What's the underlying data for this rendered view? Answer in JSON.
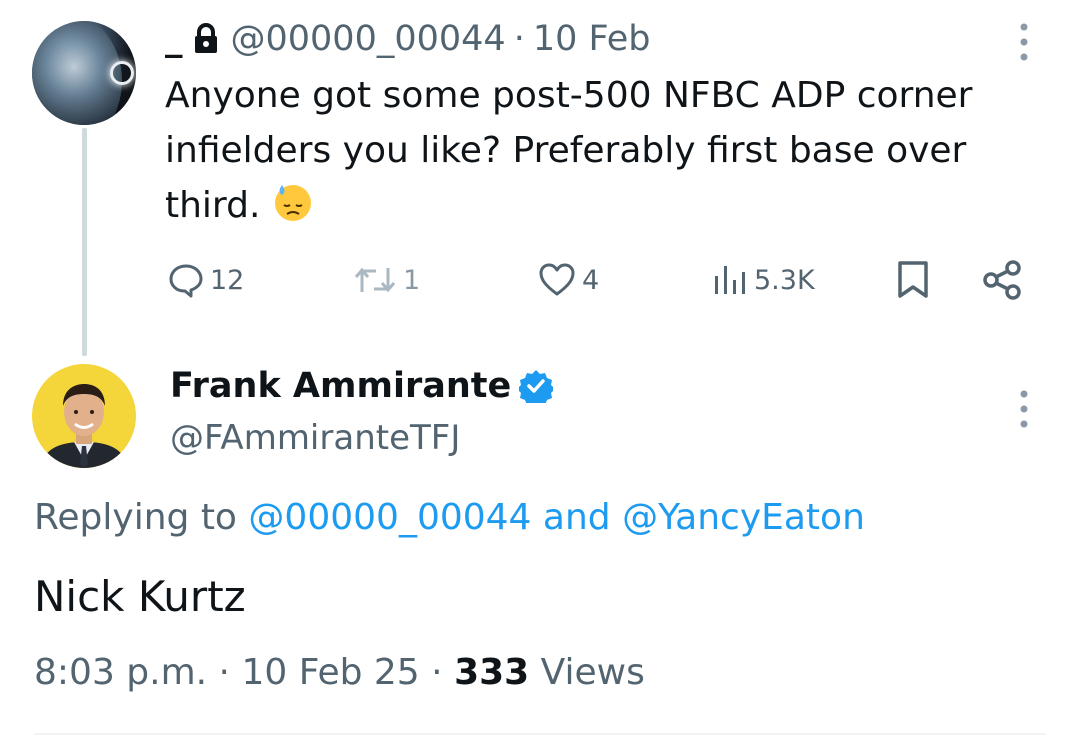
{
  "tweet": {
    "author_name": "_",
    "handle": "@00000_00044",
    "separator": "·",
    "date": "10 Feb",
    "text": "Anyone got some post-500 NFBC ADP corner infielders you like? Preferably first base over third.",
    "emoji": "😓",
    "actions": {
      "replies": "12",
      "reposts": "1",
      "likes": "4",
      "views": "5.3K"
    }
  },
  "reply": {
    "author_name": "Frank Ammirante",
    "verified": true,
    "handle": "@FAmmiranteTFJ",
    "replying_prefix": "Replying to",
    "replying_mention_1": "@00000_00044",
    "replying_and": "and",
    "replying_mention_2": "@YancyEaton",
    "text": "Nick Kurtz",
    "time": "8:03 p.m.",
    "sep1": "·",
    "date": "10 Feb 25",
    "sep2": "·",
    "views_count": "333",
    "views_label": "Views"
  },
  "colors": {
    "accent": "#1d9bf0",
    "secondary_text": "#536471",
    "primary_text": "#0f1419",
    "thread_line": "#cfd9de",
    "avatar2_bg": "#f5d63a"
  },
  "icons": [
    "lock-icon",
    "more-vertical-icon",
    "reply-icon",
    "repost-icon",
    "like-icon",
    "views-icon",
    "bookmark-icon",
    "share-icon",
    "verified-badge-icon"
  ]
}
